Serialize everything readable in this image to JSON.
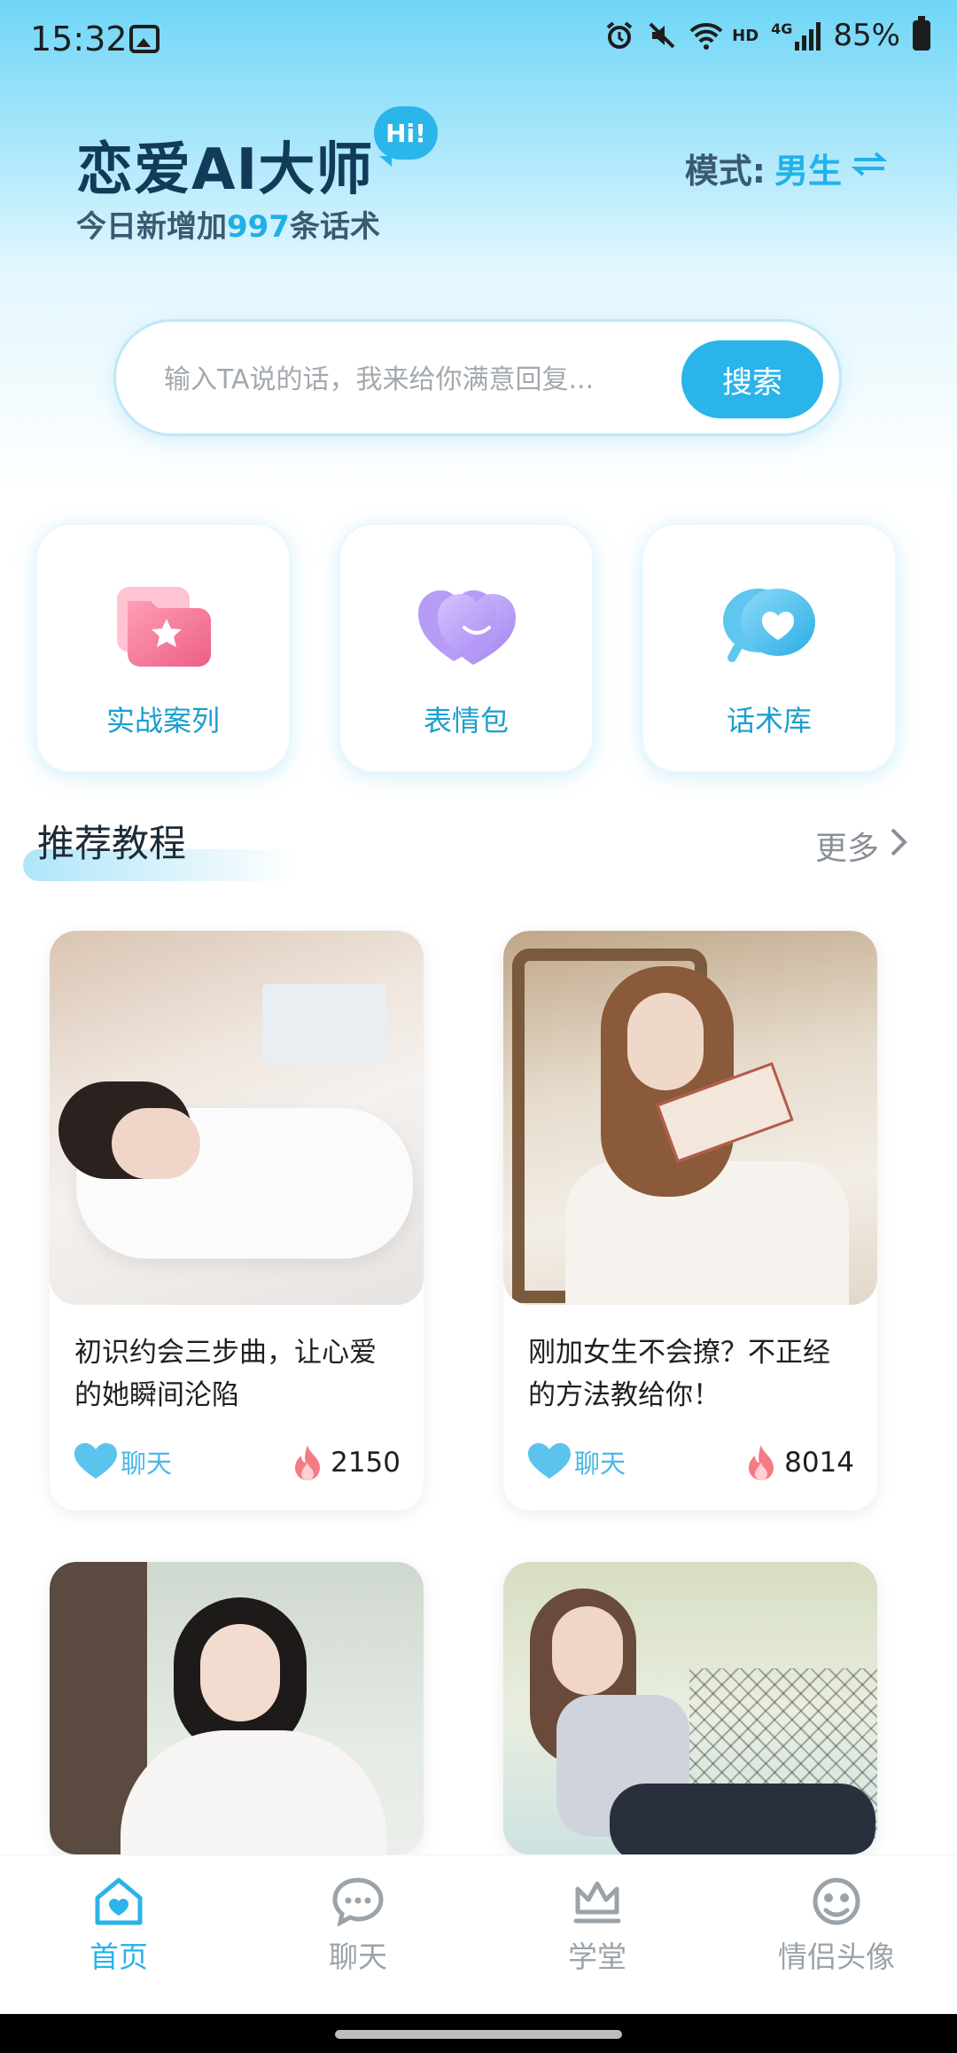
{
  "status_bar": {
    "time": "15:32",
    "battery": "85%",
    "network": "4G",
    "hd": "HD"
  },
  "header": {
    "app_title": "恋爱AI大师",
    "hi_badge": "Hi!",
    "subtitle_prefix": "今日新增加",
    "subtitle_count": "997",
    "subtitle_suffix": "条话术",
    "mode_label": "模式:",
    "mode_value": "男生"
  },
  "search": {
    "placeholder": "输入TA说的话，我来给你满意回复...",
    "button_label": "搜索"
  },
  "features": [
    {
      "label": "实战案列",
      "icon": "folder-star-icon",
      "color": "#f06d8e"
    },
    {
      "label": "表情包",
      "icon": "hearts-icon",
      "color": "#a98cf2"
    },
    {
      "label": "话术库",
      "icon": "chat-heart-icon",
      "color": "#3ebcec"
    }
  ],
  "section": {
    "title": "推荐教程",
    "more_label": "更多"
  },
  "articles": [
    {
      "title": "初识约会三步曲，让心爱的她瞬间沦陷",
      "chat_label": "聊天",
      "heat": "2150"
    },
    {
      "title": "刚加女生不会撩？不正经的方法教给你！",
      "chat_label": "聊天",
      "heat": "8014"
    },
    {
      "title": "",
      "chat_label": "",
      "heat": ""
    },
    {
      "title": "",
      "chat_label": "",
      "heat": ""
    }
  ],
  "nav": [
    {
      "label": "首页",
      "icon": "home-heart-icon",
      "active": true
    },
    {
      "label": "聊天",
      "icon": "chat-bubble-icon",
      "active": false
    },
    {
      "label": "学堂",
      "icon": "crown-icon",
      "active": false
    },
    {
      "label": "情侣头像",
      "icon": "avatar-face-icon",
      "active": false
    }
  ],
  "colors": {
    "accent": "#2ab4ea",
    "title": "#123b5a",
    "inactive_nav": "#9aa3aa"
  }
}
